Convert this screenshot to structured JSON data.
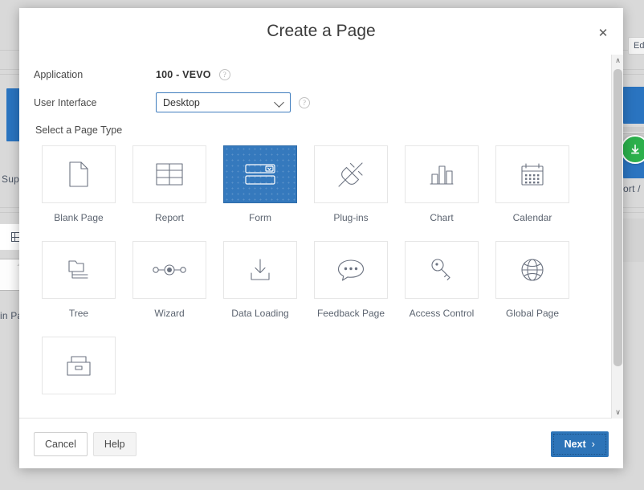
{
  "background": {
    "edit_button_label": "Ed",
    "left_label_1": "Sup",
    "left_label_2": "in Pa",
    "right_label_1": "ort /",
    "download_icon": "download-circle-icon",
    "grid_icon": "table-grid-icon",
    "doc_icon": "document-icon"
  },
  "modal": {
    "title": "Create a Page",
    "close_icon": "close-icon",
    "fields": {
      "application": {
        "label": "Application",
        "value": "100 - VEVO",
        "help_icon": "help-icon",
        "help_glyph": "?"
      },
      "user_interface": {
        "label": "User Interface",
        "value": "Desktop",
        "options": [
          "Desktop"
        ],
        "chevron_icon": "chevron-down-icon",
        "help_icon": "help-icon",
        "help_glyph": "?"
      }
    },
    "page_type": {
      "section_label": "Select a Page Type",
      "selected": "Form",
      "items": [
        {
          "label": "Blank Page",
          "icon": "blank-page-icon",
          "selected": false
        },
        {
          "label": "Report",
          "icon": "report-table-icon",
          "selected": false
        },
        {
          "label": "Form",
          "icon": "form-icon",
          "selected": true
        },
        {
          "label": "Plug-ins",
          "icon": "plug-icon",
          "selected": false
        },
        {
          "label": "Chart",
          "icon": "bar-chart-icon",
          "selected": false
        },
        {
          "label": "Calendar",
          "icon": "calendar-icon",
          "selected": false
        },
        {
          "label": "Tree",
          "icon": "tree-icon",
          "selected": false
        },
        {
          "label": "Wizard",
          "icon": "wizard-nodes-icon",
          "selected": false
        },
        {
          "label": "Data Loading",
          "icon": "data-loading-icon",
          "selected": false
        },
        {
          "label": "Feedback Page",
          "icon": "speech-bubble-icon",
          "selected": false
        },
        {
          "label": "Access Control",
          "icon": "key-icon",
          "selected": false
        },
        {
          "label": "Global Page",
          "icon": "globe-icon",
          "selected": false
        },
        {
          "label": "",
          "icon": "file-box-icon",
          "selected": false
        }
      ]
    },
    "scrollbar": {
      "up_arrow_icon": "scroll-up-arrow-icon",
      "up_glyph": "∧",
      "down_arrow_icon": "scroll-down-arrow-icon",
      "down_glyph": "∨"
    },
    "footer": {
      "cancel_label": "Cancel",
      "help_label": "Help",
      "next_label": "Next",
      "next_chevron": "›",
      "next_chevron_icon": "chevron-right-icon"
    }
  },
  "colors": {
    "accent_blue": "#2d74b8",
    "selected_tile": "#3579bd",
    "green_badge": "#2cb04c",
    "backdrop": "#d9d9d9"
  }
}
